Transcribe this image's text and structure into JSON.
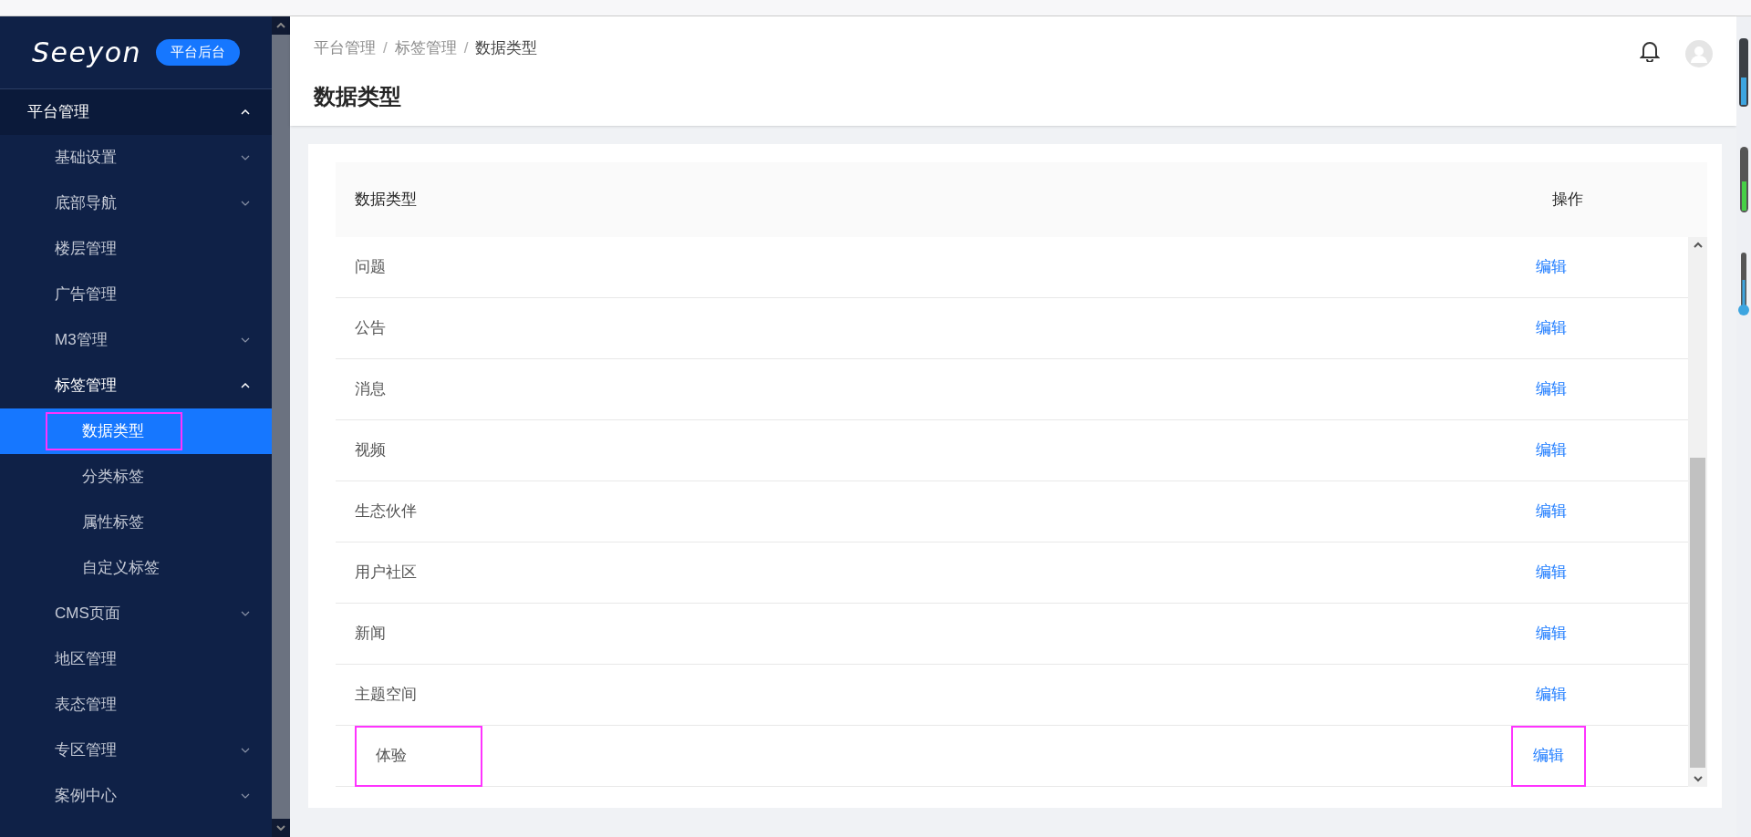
{
  "sidebar": {
    "logo": "Seeyon",
    "badge": "平台后台",
    "items": [
      {
        "label": "平台管理",
        "kind": "group",
        "expanded": true,
        "selected": false,
        "highlighted": false,
        "children": [
          {
            "label": "基础设置",
            "kind": "group",
            "expanded": false,
            "selected": false,
            "highlighted": false
          },
          {
            "label": "底部导航",
            "kind": "group",
            "expanded": false,
            "selected": false,
            "highlighted": false
          },
          {
            "label": "楼层管理",
            "kind": "link",
            "selected": false,
            "highlighted": false
          },
          {
            "label": "广告管理",
            "kind": "link",
            "selected": false,
            "highlighted": false
          },
          {
            "label": "M3管理",
            "kind": "group",
            "expanded": false,
            "selected": false,
            "highlighted": false
          },
          {
            "label": "标签管理",
            "kind": "group",
            "expanded": true,
            "selected": false,
            "highlighted": false,
            "children": [
              {
                "label": "数据类型",
                "kind": "link",
                "selected": true,
                "highlighted": true
              },
              {
                "label": "分类标签",
                "kind": "link",
                "selected": false,
                "highlighted": false
              },
              {
                "label": "属性标签",
                "kind": "link",
                "selected": false,
                "highlighted": false
              },
              {
                "label": "自定义标签",
                "kind": "link",
                "selected": false,
                "highlighted": false
              }
            ]
          },
          {
            "label": "CMS页面",
            "kind": "group",
            "expanded": false,
            "selected": false,
            "highlighted": false
          },
          {
            "label": "地区管理",
            "kind": "link",
            "selected": false,
            "highlighted": false
          },
          {
            "label": "表态管理",
            "kind": "link",
            "selected": false,
            "highlighted": false
          },
          {
            "label": "专区管理",
            "kind": "group",
            "expanded": false,
            "selected": false,
            "highlighted": false
          },
          {
            "label": "案例中心",
            "kind": "group",
            "expanded": false,
            "selected": false,
            "highlighted": false
          }
        ]
      }
    ]
  },
  "breadcrumb": [
    {
      "kind": "link",
      "text": "平台管理"
    },
    {
      "kind": "separator",
      "text": "/"
    },
    {
      "kind": "link",
      "text": "标签管理"
    },
    {
      "kind": "separator",
      "text": "/"
    },
    {
      "kind": "current",
      "text": "数据类型"
    }
  ],
  "page_title": "数据类型",
  "table": {
    "columns": [
      "数据类型",
      "操作"
    ],
    "rows": [
      {
        "name": "问题",
        "action": "编辑",
        "name_highlighted": false,
        "action_highlighted": false
      },
      {
        "name": "公告",
        "action": "编辑",
        "name_highlighted": false,
        "action_highlighted": false
      },
      {
        "name": "消息",
        "action": "编辑",
        "name_highlighted": false,
        "action_highlighted": false
      },
      {
        "name": "视频",
        "action": "编辑",
        "name_highlighted": false,
        "action_highlighted": false
      },
      {
        "name": "生态伙伴",
        "action": "编辑",
        "name_highlighted": false,
        "action_highlighted": false
      },
      {
        "name": "用户社区",
        "action": "编辑",
        "name_highlighted": false,
        "action_highlighted": false
      },
      {
        "name": "新闻",
        "action": "编辑",
        "name_highlighted": false,
        "action_highlighted": false
      },
      {
        "name": "主题空间",
        "action": "编辑",
        "name_highlighted": false,
        "action_highlighted": false
      },
      {
        "name": "体验",
        "action": "编辑",
        "name_highlighted": true,
        "action_highlighted": true
      }
    ]
  }
}
